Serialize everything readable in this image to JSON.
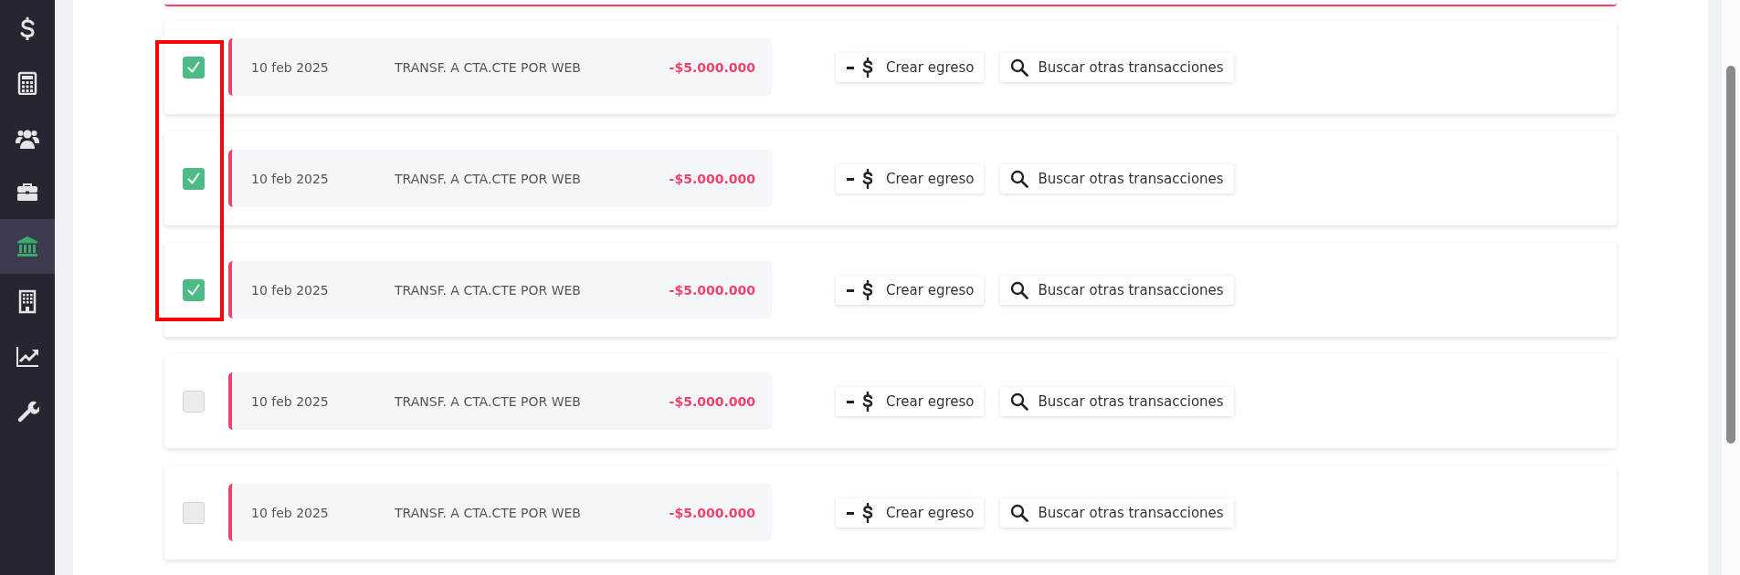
{
  "sidebar": {
    "items": [
      {
        "kind": "dollar",
        "selected": false
      },
      {
        "kind": "calculator",
        "selected": false
      },
      {
        "kind": "users",
        "selected": false
      },
      {
        "kind": "briefcase",
        "selected": false
      },
      {
        "kind": "bank",
        "selected": true
      },
      {
        "kind": "building",
        "selected": false
      },
      {
        "kind": "chart",
        "selected": false
      },
      {
        "kind": "wrench",
        "selected": false
      }
    ]
  },
  "transactions": [
    {
      "checked": true,
      "date": "10 feb 2025",
      "description": "TRANSF. A CTA.CTE POR WEB",
      "amount": "-$5.000.000",
      "actions": [
        "Crear egreso",
        "Buscar otras transacciones"
      ]
    },
    {
      "checked": true,
      "date": "10 feb 2025",
      "description": "TRANSF. A CTA.CTE POR WEB",
      "amount": "-$5.000.000",
      "actions": [
        "Crear egreso",
        "Buscar otras transacciones"
      ]
    },
    {
      "checked": true,
      "date": "10 feb 2025",
      "description": "TRANSF. A CTA.CTE POR WEB",
      "amount": "-$5.000.000",
      "actions": [
        "Crear egreso",
        "Buscar otras transacciones"
      ]
    },
    {
      "checked": false,
      "date": "10 feb 2025",
      "description": "TRANSF. A CTA.CTE POR WEB",
      "amount": "-$5.000.000",
      "actions": [
        "Crear egreso",
        "Buscar otras transacciones"
      ]
    },
    {
      "checked": false,
      "date": "10 feb 2025",
      "description": "TRANSF. A CTA.CTE POR WEB",
      "amount": "-$5.000.000",
      "actions": [
        "Crear egreso",
        "Buscar otras transacciones"
      ]
    }
  ]
}
